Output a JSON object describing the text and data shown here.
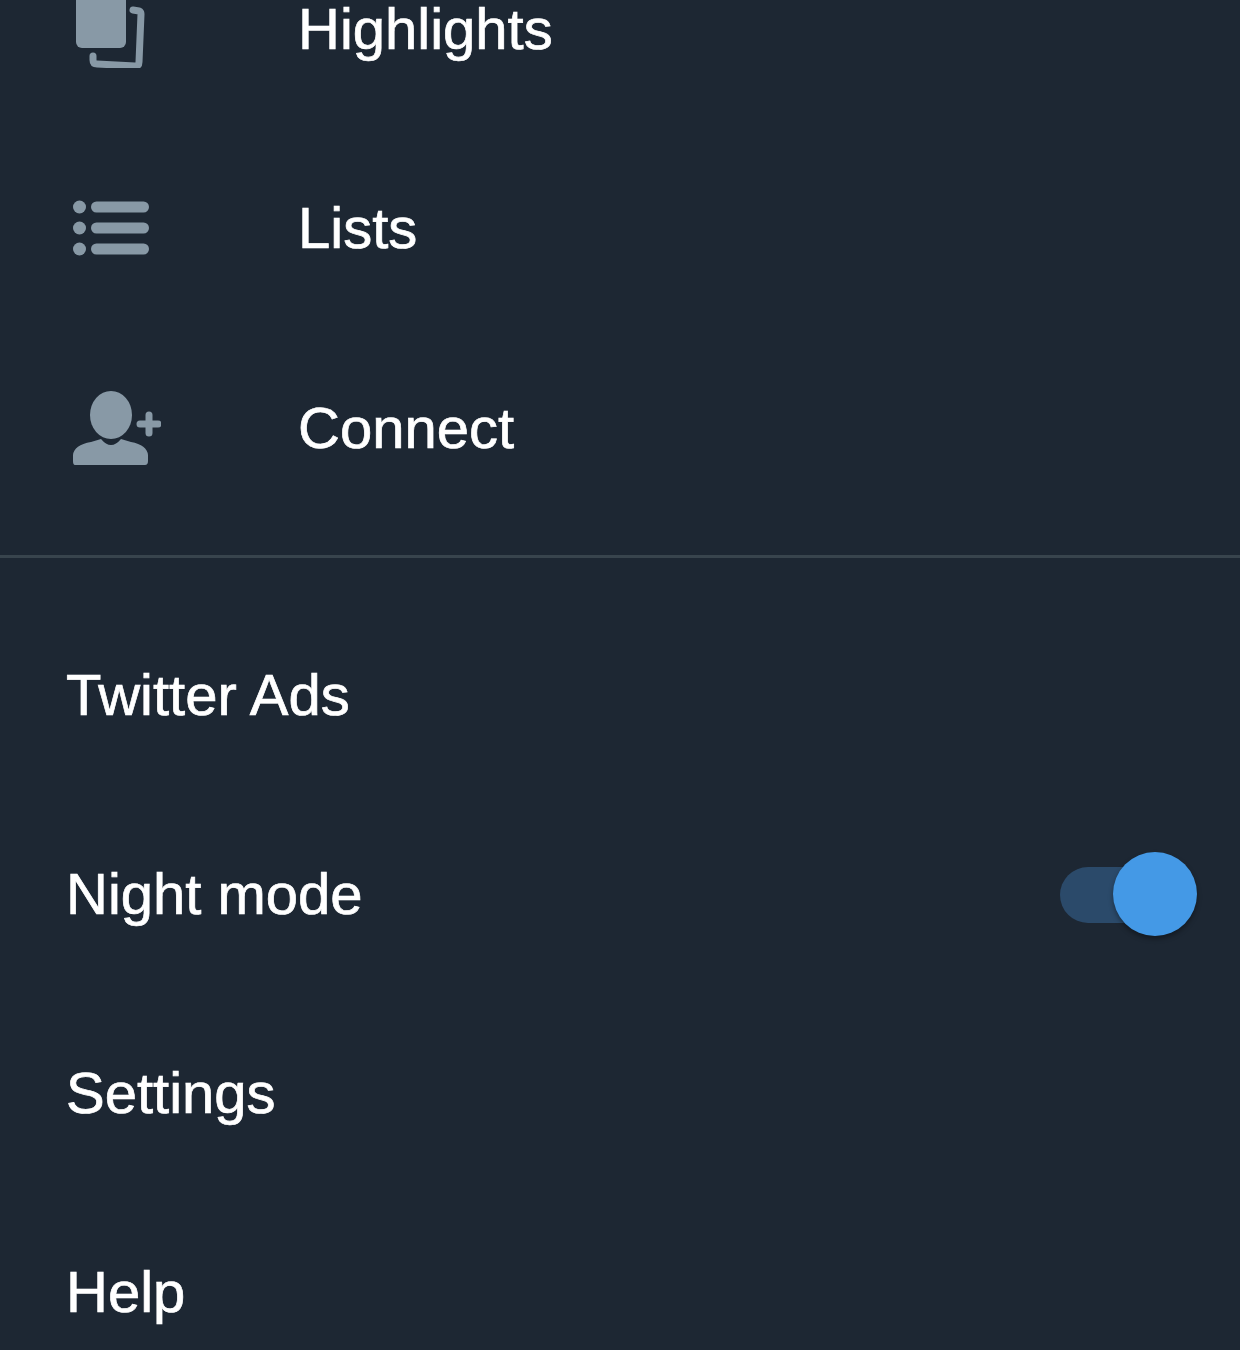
{
  "nav_items": [
    {
      "label": "Highlights"
    },
    {
      "label": "Lists"
    },
    {
      "label": "Connect"
    }
  ],
  "menu_items": [
    {
      "kind": "link",
      "label": "Twitter Ads"
    },
    {
      "kind": "toggle",
      "label": "Night mode",
      "on": true
    },
    {
      "kind": "link",
      "label": "Settings"
    },
    {
      "kind": "link",
      "label": "Help"
    }
  ]
}
